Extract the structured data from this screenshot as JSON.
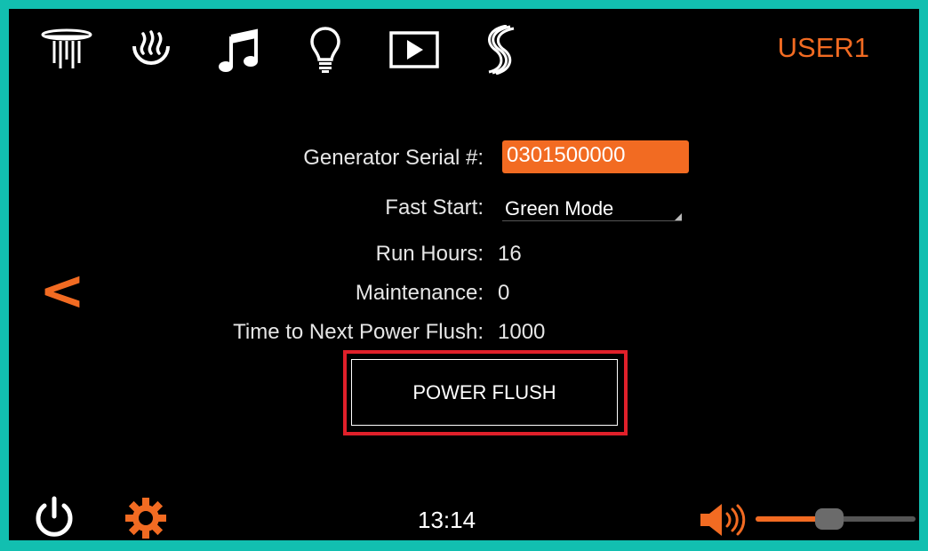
{
  "header": {
    "user_label": "USER1",
    "nav_icons": [
      "shower-head-icon",
      "steam-icon",
      "music-icon",
      "light-bulb-icon",
      "video-play-icon",
      "brand-s-icon"
    ]
  },
  "form": {
    "serial_label": "Generator Serial #:",
    "serial_value": "0301500000",
    "fast_start_label": "Fast Start:",
    "fast_start_value": "Green Mode",
    "run_hours_label": "Run Hours:",
    "run_hours_value": "16",
    "maintenance_label": "Maintenance:",
    "maintenance_value": "0",
    "next_flush_label": "Time to Next Power Flush:",
    "next_flush_value": "1000",
    "power_flush_button": "POWER FLUSH"
  },
  "nav": {
    "back_label": "<"
  },
  "footer": {
    "time": "13:14",
    "volume_level": 0.46
  },
  "colors": {
    "accent": "#f26b22",
    "frame": "#12bfb0",
    "highlight": "#e0202a"
  }
}
